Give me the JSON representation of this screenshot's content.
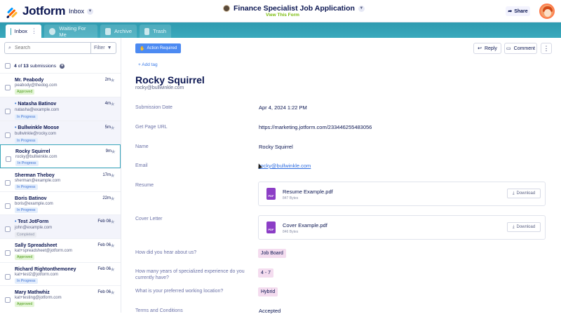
{
  "app": {
    "logo_text": "Jotform",
    "inbox_label": "Inbox",
    "form_title": "Finance Specialist Job Application",
    "view_form_label": "View This Form",
    "share_label": "Share"
  },
  "tabs": [
    {
      "label": "Inbox",
      "icon": "inbox-icon",
      "active": true
    },
    {
      "label": "Waiting For Me",
      "icon": "waiting-icon",
      "active": false
    },
    {
      "label": "Archive",
      "icon": "archive-icon",
      "active": false
    },
    {
      "label": "Trash",
      "icon": "trash-icon",
      "active": false
    }
  ],
  "sidebar": {
    "search_placeholder": "Search",
    "filter_label": "Filter",
    "count_selected": "4",
    "count_of": "of",
    "count_total": "13",
    "count_suffix": "submissions",
    "submissions": [
      {
        "name": "Mr. Peabody",
        "email": "peabody@thedog.com",
        "status": "Approved",
        "time": "2m",
        "unread": false,
        "selected": false
      },
      {
        "name": "Natasha Batinov",
        "email": "natasha@example.com",
        "status": "In Progress",
        "time": "4m",
        "unread": true,
        "selected": false
      },
      {
        "name": "Bullwinkle Moose",
        "email": "bullwinkle@rocky.com",
        "status": "In Progress",
        "time": "5m",
        "unread": true,
        "selected": false
      },
      {
        "name": "Rocky Squirrel",
        "email": "rocky@bullwinkle.com",
        "status": "In Progress",
        "time": "9m",
        "unread": false,
        "selected": true
      },
      {
        "name": "Sherman Theboy",
        "email": "sherman@example.com",
        "status": "In Progress",
        "time": "17m",
        "unread": false,
        "selected": false
      },
      {
        "name": "Boris Batinov",
        "email": "boris@example.com",
        "status": "In Progress",
        "time": "22m",
        "unread": false,
        "selected": false
      },
      {
        "name": "Test JotForm",
        "email": "john@example.com",
        "status": "Completed",
        "time": "Feb 08",
        "unread": true,
        "selected": false
      },
      {
        "name": "Sally Spreadsheet",
        "email": "kat+spreadsheet@jotform.com",
        "status": "Approved",
        "time": "Feb 06",
        "unread": false,
        "selected": false
      },
      {
        "name": "Richard Rightonthemoney",
        "email": "kat+test2@jotform.com",
        "status": "In Progress",
        "time": "Feb 06",
        "unread": false,
        "selected": false
      },
      {
        "name": "Mary Mathwhiz",
        "email": "kat+testing@jotform.com",
        "status": "Approved",
        "time": "Feb 06",
        "unread": false,
        "selected": false
      }
    ]
  },
  "detail": {
    "action_required_label": "Action Required",
    "reply_label": "Reply",
    "comment_label": "Comment",
    "add_tag_label": "+ Add tag",
    "name": "Rocky Squirrel",
    "email": "rocky@bullwinkle.com",
    "fields": {
      "submission_date_label": "Submission Date",
      "submission_date_value": "Apr 4, 2024 1:22 PM",
      "page_url_label": "Get Page URL",
      "page_url_value": "https://marketing.jotform.com/233446255483056",
      "name_label": "Name",
      "name_value": "Rocky Squirrel",
      "email_label": "Email",
      "email_value": "rocky@bullwinkle.com",
      "resume_label": "Resume",
      "resume_file": "Resume Example.pdf",
      "resume_size": "847 Bytes",
      "cover_label": "Cover Letter",
      "cover_file": "Cover Example.pdf",
      "cover_size": "846 Bytes",
      "download_label": "Download",
      "pdf_label": "PDF",
      "hear_label": "How did you hear about us?",
      "hear_value": "Job Board",
      "years_label": "How many years of specialized experience do you currently have?",
      "years_value": "4 - 7",
      "location_label": "What is your preferred working location?",
      "location_value": "Hybrid",
      "terms_label": "Terms and Conditions",
      "terms_value": "Accepted"
    }
  }
}
